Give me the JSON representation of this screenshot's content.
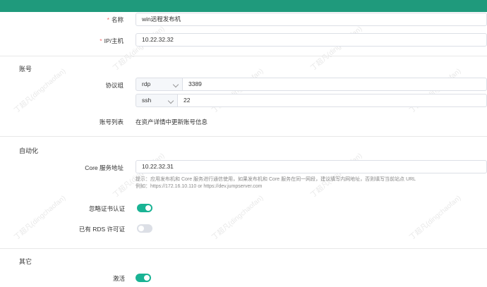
{
  "basic": {
    "name_label": "名称",
    "name_value": "win远程发布机",
    "ip_label": "IP/主机",
    "ip_value": "10.22.32.32"
  },
  "account": {
    "title": "账号",
    "protocol_group_label": "协议组",
    "protocols": [
      {
        "name": "rdp",
        "port": "3389"
      },
      {
        "name": "ssh",
        "port": "22"
      }
    ],
    "account_list_label": "账号列表",
    "account_list_text": "在资产详情中更新账号信息"
  },
  "automation": {
    "title": "自动化",
    "core_label": "Core 服务地址",
    "core_value": "10.22.32.31",
    "hint_line1": "提示：应用发布机和 Core 服务进行通信使用，如果发布机和 Core 服务在同一网段，建议填写内网地址，否则填写当前站点 URL",
    "hint_line2": "例如：https://172.16.10.110 or https://dev.jumpserver.com",
    "ignore_cert_label": "忽略证书认证",
    "ignore_cert_on": true,
    "rds_license_label": "已有 RDS 许可证",
    "rds_license_on": false
  },
  "other": {
    "title": "其它",
    "active_label": "激活",
    "active_on": true
  },
  "watermark": "丁超凡(dingchaofan)",
  "colors": {
    "topbar": "#1f9a7c",
    "switch_on": "#1ab394",
    "switch_off": "#dcdfe6",
    "required": "#f56c6c"
  }
}
